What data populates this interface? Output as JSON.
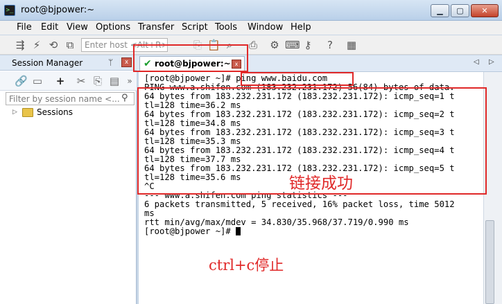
{
  "window": {
    "title": "root@bjpower:~",
    "icon": "terminal-app-icon",
    "min": "▁",
    "max": "▢",
    "close": "✕"
  },
  "menu": {
    "items": [
      "File",
      "Edit",
      "View",
      "Options",
      "Transfer",
      "Script",
      "Tools",
      "Window",
      "Help"
    ]
  },
  "toolbar": {
    "host_placeholder": "Enter host <Alt+R>",
    "icons": [
      "connect-icon",
      "lightning-icon",
      "reconnect-icon",
      "disconnect-icon",
      "copy-icon",
      "paste-icon",
      "find-icon",
      "print-icon",
      "settings-icon",
      "keymap-icon",
      "key-icon",
      "help-icon",
      "sftp-icon"
    ]
  },
  "session_manager": {
    "title": "Session Manager",
    "pin": "ᛘ",
    "close": "x",
    "filter_placeholder": "Filter by session name <...",
    "tree": {
      "expander": "▷",
      "label": "Sessions"
    }
  },
  "tabs": {
    "active": {
      "label": "root@bjpower:~",
      "status": "✔",
      "close": "x"
    },
    "prev": "◁",
    "next": "▷"
  },
  "terminal": {
    "lines": [
      "[root@bjpower ~]# ping www.baidu.com",
      "PING www.a.shifen.com (183.232.231.172) 56(84) bytes of data.",
      "64 bytes from 183.232.231.172 (183.232.231.172): icmp_seq=1 t",
      "tl=128 time=36.2 ms",
      "64 bytes from 183.232.231.172 (183.232.231.172): icmp_seq=2 t",
      "tl=128 time=34.8 ms",
      "64 bytes from 183.232.231.172 (183.232.231.172): icmp_seq=3 t",
      "tl=128 time=35.3 ms",
      "64 bytes from 183.232.231.172 (183.232.231.172): icmp_seq=4 t",
      "tl=128 time=37.7 ms",
      "64 bytes from 183.232.231.172 (183.232.231.172): icmp_seq=5 t",
      "tl=128 time=35.6 ms",
      "^C",
      "--- www.a.shifen.com ping statistics ---",
      "6 packets transmitted, 5 received, 16% packet loss, time 5012",
      "ms",
      "rtt min/avg/max/mdev = 34.830/35.968/37.719/0.990 ms",
      "[root@bjpower ~]# "
    ]
  },
  "annotations": {
    "success": "链接成功",
    "ctrlc": "ctrl+c停止",
    "color": "#e02828"
  }
}
